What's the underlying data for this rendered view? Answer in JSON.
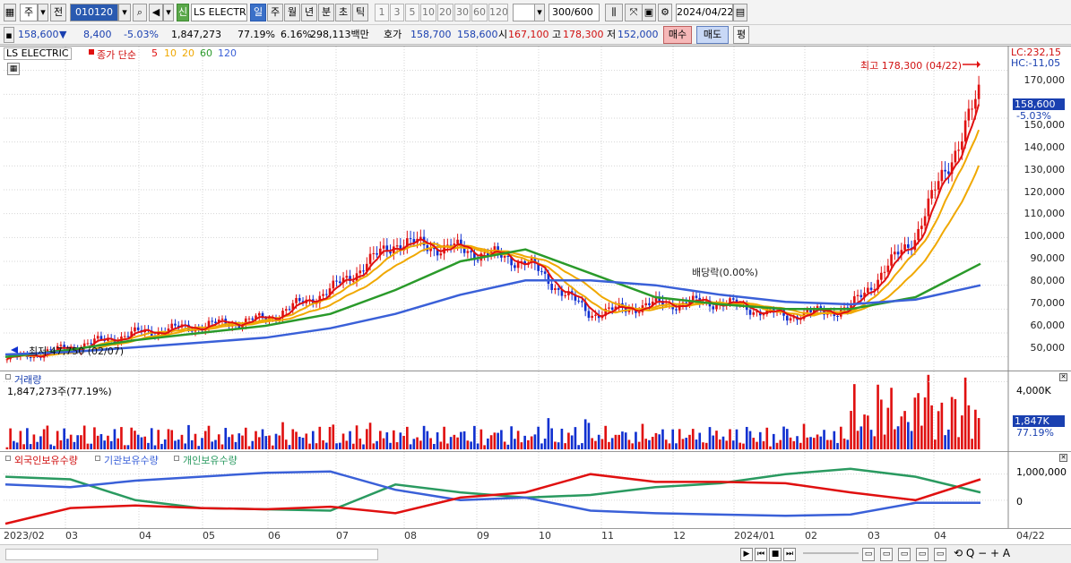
{
  "toolbar": {
    "market": "주",
    "prev_label": "전",
    "code": "010120",
    "new_badge": "신",
    "name": "LS ELECTRI",
    "periods": [
      "일",
      "주",
      "월",
      "년",
      "분",
      "초",
      "틱"
    ],
    "active_period": "일",
    "numbers": [
      "1",
      "3",
      "5",
      "10",
      "20",
      "30",
      "60",
      "120"
    ],
    "count": "300",
    "count_total": "/600",
    "date": "2024/04/22"
  },
  "info": {
    "price": "158,600",
    "arrow": "▼",
    "change": "8,400",
    "change_pct": "-5.03%",
    "volume": "1,847,273",
    "vol_ratio": "77.19%",
    "turnover": "6.16%",
    "amount": "298,113백만",
    "bid_label": "호가",
    "bid1": "158,700",
    "bid2": "158,600",
    "open_label": "시",
    "open": "167,100",
    "high_label": "고",
    "high": "178,300",
    "low_label": "저",
    "low": "152,000",
    "buy_label": "매수",
    "sell_label": "매도",
    "eval_label": "평"
  },
  "legend": {
    "name": "LS ELECTRIC",
    "close_label": "종가 단순",
    "ma": [
      "5",
      "10",
      "20",
      "60",
      "120"
    ]
  },
  "price_axis": {
    "lc": "LC:232,15",
    "hc": "HC:-11,05",
    "ticks": [
      "170,000",
      "160,000",
      "150,000",
      "140,000",
      "130,000",
      "120,000",
      "110,000",
      "100,000",
      "90,000",
      "80,000",
      "70,000",
      "60,000",
      "50,000"
    ],
    "current": "158,600",
    "current_pct": "-5.03%"
  },
  "annotations": {
    "high": "최고 178,300 (04/22)",
    "low": "최저 47,750 (02/07)",
    "dividend": "배당락(0.00%)"
  },
  "volume_pane": {
    "title": "거래량",
    "value": "1,847,273주(77.19%)",
    "tick": "4,000K",
    "current": "1,847K",
    "current_pct": "77.19%"
  },
  "holdings_pane": {
    "series": [
      "외국인보유수량",
      "기관보유수량",
      "개인보유수량"
    ],
    "ticks": [
      "1,000,000",
      "0"
    ]
  },
  "x_labels": [
    "2023/02",
    "03",
    "04",
    "05",
    "06",
    "07",
    "08",
    "09",
    "10",
    "11",
    "12",
    "2024/01",
    "02",
    "03",
    "04"
  ],
  "x_last": "04/22",
  "colors": {
    "candle_up": "#e01010",
    "candle_down": "#1030d0",
    "ma5": "#e01010",
    "ma10": "#f0a800",
    "ma20": "#f0a800",
    "ma60": "#2a9a2a",
    "ma120": "#3a60d8",
    "foreign": "#e01010",
    "institution": "#3a60d8",
    "individual": "#2a9a60"
  },
  "chart_data": {
    "type": "candlestick",
    "title": "LS ELECTRIC",
    "x": [
      "2023/02",
      "03",
      "04",
      "05",
      "06",
      "07",
      "08",
      "09",
      "10",
      "11",
      "12",
      "2024/01",
      "02",
      "03",
      "04",
      "04/22"
    ],
    "price_close": [
      49000,
      54000,
      60000,
      63000,
      66000,
      78000,
      98000,
      95000,
      90000,
      68000,
      72000,
      73000,
      67000,
      70000,
      100000,
      158600
    ],
    "ma60": [
      50000,
      53000,
      57000,
      60000,
      63000,
      68000,
      78000,
      90000,
      95000,
      85000,
      75000,
      72000,
      70000,
      70000,
      75000,
      89000
    ],
    "ma120": [
      51000,
      52000,
      54000,
      56000,
      58000,
      62000,
      68000,
      76000,
      82000,
      82000,
      80000,
      76000,
      73000,
      72000,
      74000,
      80000
    ],
    "volume_last": 1847273,
    "ylim": [
      45000,
      180000
    ],
    "holdings": {
      "foreign": [
        -900000,
        -300000,
        -200000,
        -300000,
        -350000,
        -250000,
        -500000,
        100000,
        300000,
        1000000,
        700000,
        700000,
        650000,
        300000,
        0,
        800000
      ],
      "institution": [
        600000,
        500000,
        750000,
        900000,
        1050000,
        1100000,
        400000,
        0,
        100000,
        -400000,
        -500000,
        -550000,
        -600000,
        -550000,
        -100000,
        -100000
      ],
      "individual": [
        900000,
        800000,
        0,
        -300000,
        -350000,
        -400000,
        600000,
        300000,
        100000,
        200000,
        500000,
        650000,
        1000000,
        1200000,
        900000,
        300000
      ]
    }
  }
}
